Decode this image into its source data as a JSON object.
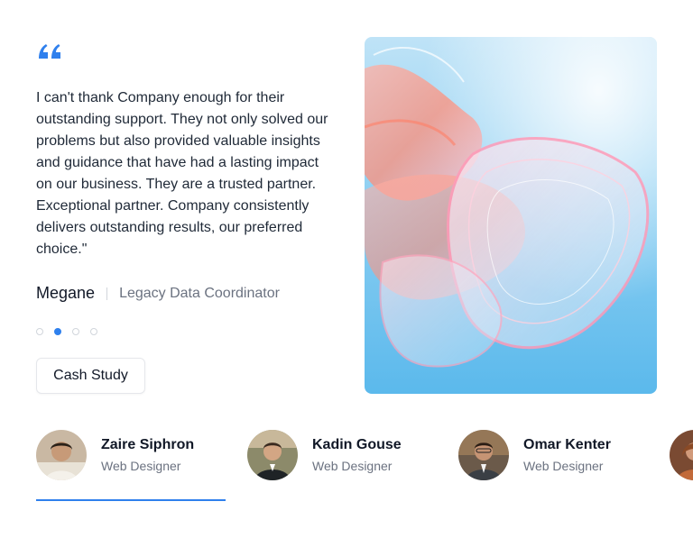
{
  "testimonial": {
    "quote": "I can't thank Company enough for their outstanding support. They not only solved our problems but also provided valuable insights and guidance that have had a lasting impact on our business. They are a trusted partner. Exceptional partner. Company consistently delivers outstanding results, our preferred choice.\"",
    "author_name": "Megane",
    "author_role": "Legacy Data Coordinator",
    "quote_icon": "quote-icon",
    "accent_color": "#2f80ed"
  },
  "pagination": {
    "count": 4,
    "active_index": 1
  },
  "cta": {
    "label": "Cash Study"
  },
  "hero_image": {
    "icon": "abstract-glass-image"
  },
  "people": [
    {
      "name": "Zaire Siphron",
      "role": "Web Designer",
      "active": true
    },
    {
      "name": "Kadin Gouse",
      "role": "Web Designer",
      "active": false
    },
    {
      "name": "Omar Kenter",
      "role": "Web Designer",
      "active": false
    },
    {
      "name": "",
      "role": "",
      "active": false
    }
  ]
}
